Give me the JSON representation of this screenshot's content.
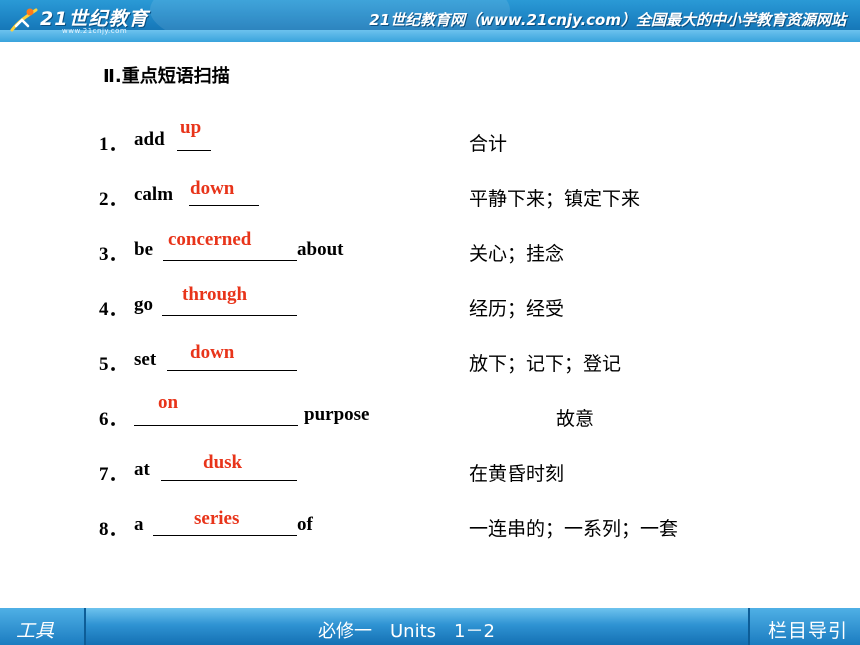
{
  "header": {
    "logo_text": "21世纪教育",
    "logo_url": "www.21cnjy.com",
    "slogan": "21世纪教育网（www.21cnjy.com）全国最大的中小学教育资源网站"
  },
  "section_title": "Ⅱ.重点短语扫描",
  "phrases": [
    {
      "num": "1．",
      "before": "add",
      "answer": "up",
      "after": "",
      "meaning": "合计"
    },
    {
      "num": "2．",
      "before": "calm",
      "answer": "down",
      "after": "",
      "meaning": "平静下来；镇定下来"
    },
    {
      "num": "3．",
      "before": "be",
      "answer": "concerned",
      "after": "about",
      "meaning": "关心；挂念"
    },
    {
      "num": "4．",
      "before": "go",
      "answer": "through",
      "after": "",
      "meaning": "经历；经受"
    },
    {
      "num": "5．",
      "before": "set",
      "answer": "down",
      "after": "",
      "meaning": "放下；记下；登记"
    },
    {
      "num": "6．",
      "before": "",
      "answer": "on",
      "after": "purpose",
      "meaning": "故意"
    },
    {
      "num": "7．",
      "before": "at",
      "answer": "dusk",
      "after": "",
      "meaning": "在黄昏时刻"
    },
    {
      "num": "8．",
      "before": "a",
      "answer": "series",
      "after": "of",
      "meaning": "一连串的；一系列；一套"
    }
  ],
  "footer": {
    "tools_label": "工具",
    "course_label": "必修一　Units　1－2",
    "nav_label": "栏目导引"
  },
  "colors": {
    "answer": "#e8341a",
    "header_blue": "#1a7fc0"
  }
}
